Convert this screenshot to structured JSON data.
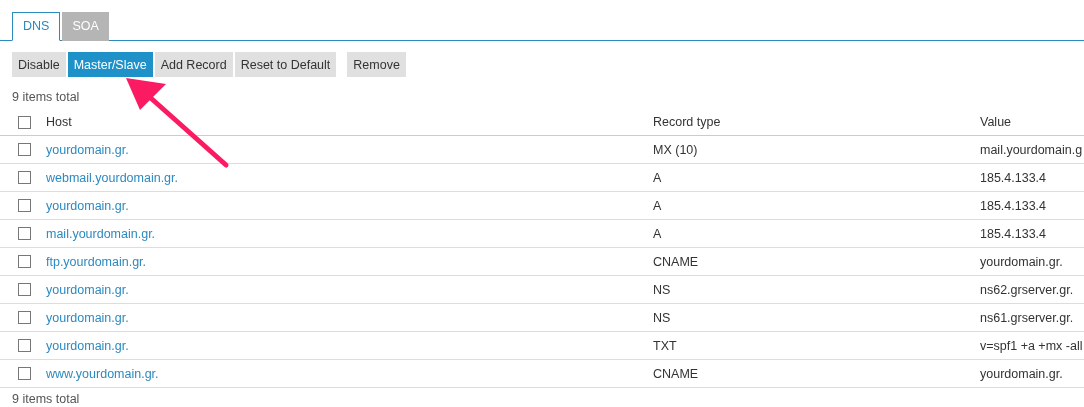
{
  "tabs": [
    {
      "label": "DNS",
      "selected": true
    },
    {
      "label": "SOA",
      "selected": false
    }
  ],
  "toolbar": [
    {
      "label": "Disable",
      "selected": false
    },
    {
      "label": "Master/Slave",
      "selected": true
    },
    {
      "label": "Add Record",
      "selected": false
    },
    {
      "label": "Reset to Default",
      "selected": false
    },
    {
      "label": "Remove",
      "selected": false,
      "kind": "separate"
    }
  ],
  "items_total_top": "9 items total",
  "table": {
    "columns": [
      "Host",
      "Record type",
      "Value"
    ],
    "header_checked": false,
    "rows": [
      {
        "host": "yourdomain.gr.",
        "type": "MX (10)",
        "value": "mail.yourdomain.g",
        "checked": false
      },
      {
        "host": "webmail.yourdomain.gr.",
        "type": "A",
        "value": "185.4.133.4",
        "checked": false
      },
      {
        "host": "yourdomain.gr.",
        "type": "A",
        "value": "185.4.133.4",
        "checked": false
      },
      {
        "host": "mail.yourdomain.gr.",
        "type": "A",
        "value": "185.4.133.4",
        "checked": false
      },
      {
        "host": "ftp.yourdomain.gr.",
        "type": "CNAME",
        "value": "yourdomain.gr.",
        "checked": false
      },
      {
        "host": "yourdomain.gr.",
        "type": "NS",
        "value": "ns62.grserver.gr.",
        "checked": false
      },
      {
        "host": "yourdomain.gr.",
        "type": "NS",
        "value": "ns61.grserver.gr.",
        "checked": false
      },
      {
        "host": "yourdomain.gr.",
        "type": "TXT",
        "value": "v=spf1 +a +mx -all",
        "checked": false
      },
      {
        "host": "www.yourdomain.gr.",
        "type": "CNAME",
        "value": "yourdomain.gr.",
        "checked": false
      }
    ]
  },
  "items_total_bottom": "9 items total"
}
